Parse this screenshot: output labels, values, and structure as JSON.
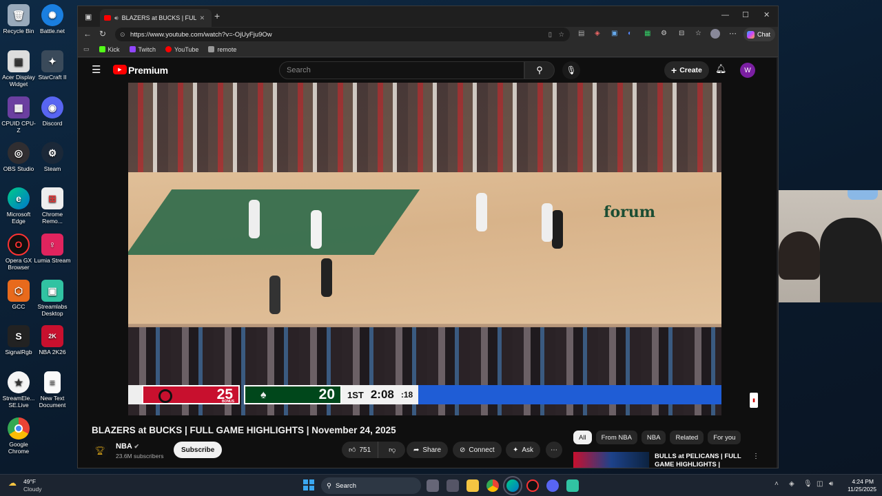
{
  "desktop": {
    "icons": [
      {
        "label": "Recycle Bin"
      },
      {
        "label": "Battle.net"
      },
      {
        "label": "Acer Display Widget"
      },
      {
        "label": "StarCraft II"
      },
      {
        "label": "CPUID CPU-Z"
      },
      {
        "label": "Discord"
      },
      {
        "label": "OBS Studio"
      },
      {
        "label": "Steam"
      },
      {
        "label": "Microsoft Edge"
      },
      {
        "label": "Chrome Remo..."
      },
      {
        "label": "Opera GX Browser"
      },
      {
        "label": "Lumia Stream"
      },
      {
        "label": "GCC"
      },
      {
        "label": "Streamlabs Desktop"
      },
      {
        "label": "SignalRgb"
      },
      {
        "label": "NBA 2K26"
      },
      {
        "label": "StreamEle... SE.Live"
      },
      {
        "label": "New Text Document"
      },
      {
        "label": "Google Chrome"
      }
    ]
  },
  "browser": {
    "tab_title": "BLAZERS at BUCKS | FULL GA...",
    "url": "https://www.youtube.com/watch?v=-OjUyFju9Ow",
    "bookmarks": [
      "Kick",
      "Twitch",
      "YouTube",
      "remote"
    ],
    "chat_label": "Chat"
  },
  "youtube": {
    "logo_text": "Premium",
    "search_placeholder": "Search",
    "create_label": "Create",
    "avatar_letter": "W",
    "video_title": "BLAZERS at BUCKS | FULL GAME HIGHLIGHTS | November 24, 2025",
    "channel_name": "NBA",
    "subscribers": "23.6M subscribers",
    "subscribe_label": "Subscribe",
    "likes": "751",
    "share_label": "Share",
    "connect_label": "Connect",
    "ask_label": "Ask",
    "chips": [
      "All",
      "From NBA",
      "NBA",
      "Related",
      "For you"
    ],
    "rec_title": "BULLS at PELICANS | FULL GAME HIGHLIGHTS | Novemb..."
  },
  "scoreboard": {
    "away_score": "25",
    "away_bonus": "BONUS",
    "home_score": "20",
    "quarter": "1ST",
    "clock": "2:08",
    "shot_clock": ":18",
    "court_text": "forum"
  },
  "colors": {
    "blazers_red": "#c8102e",
    "bucks_green": "#00471b",
    "youtube_red": "#ff0000"
  },
  "taskbar": {
    "weather_temp": "49°F",
    "weather_desc": "Cloudy",
    "search_label": "Search",
    "time": "4:24 PM",
    "date": "11/25/2025"
  }
}
